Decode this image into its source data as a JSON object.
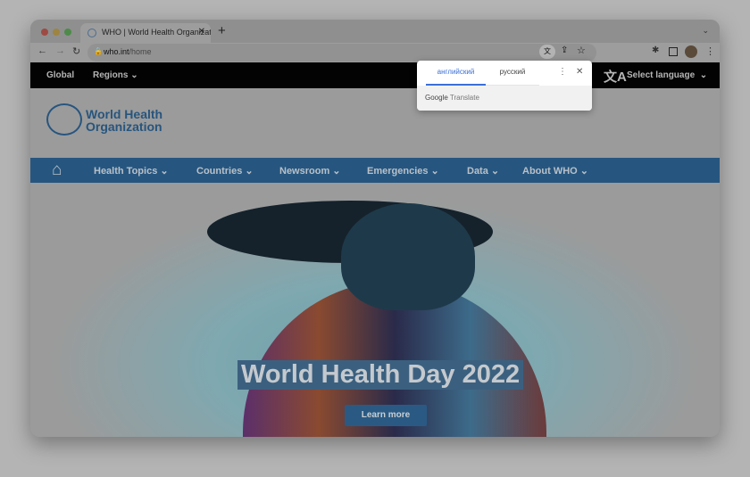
{
  "browser": {
    "tab_title": "WHO | World Health Organization",
    "url_domain": "who.int",
    "url_path": "/home"
  },
  "topbar": {
    "global": "Global",
    "regions": "Regions",
    "select_language": "Select language"
  },
  "logo": {
    "line1": "World Health",
    "line2": "Organization"
  },
  "nav": {
    "items": [
      "Health Topics",
      "Countries",
      "Newsroom",
      "Emergencies",
      "Data",
      "About WHO"
    ]
  },
  "hero": {
    "title": "World Health Day 2022",
    "button": "Learn more"
  },
  "translate_popup": {
    "source_lang": "английский",
    "target_lang": "русский",
    "footer_brand": "Google",
    "footer_product": "Translate"
  }
}
